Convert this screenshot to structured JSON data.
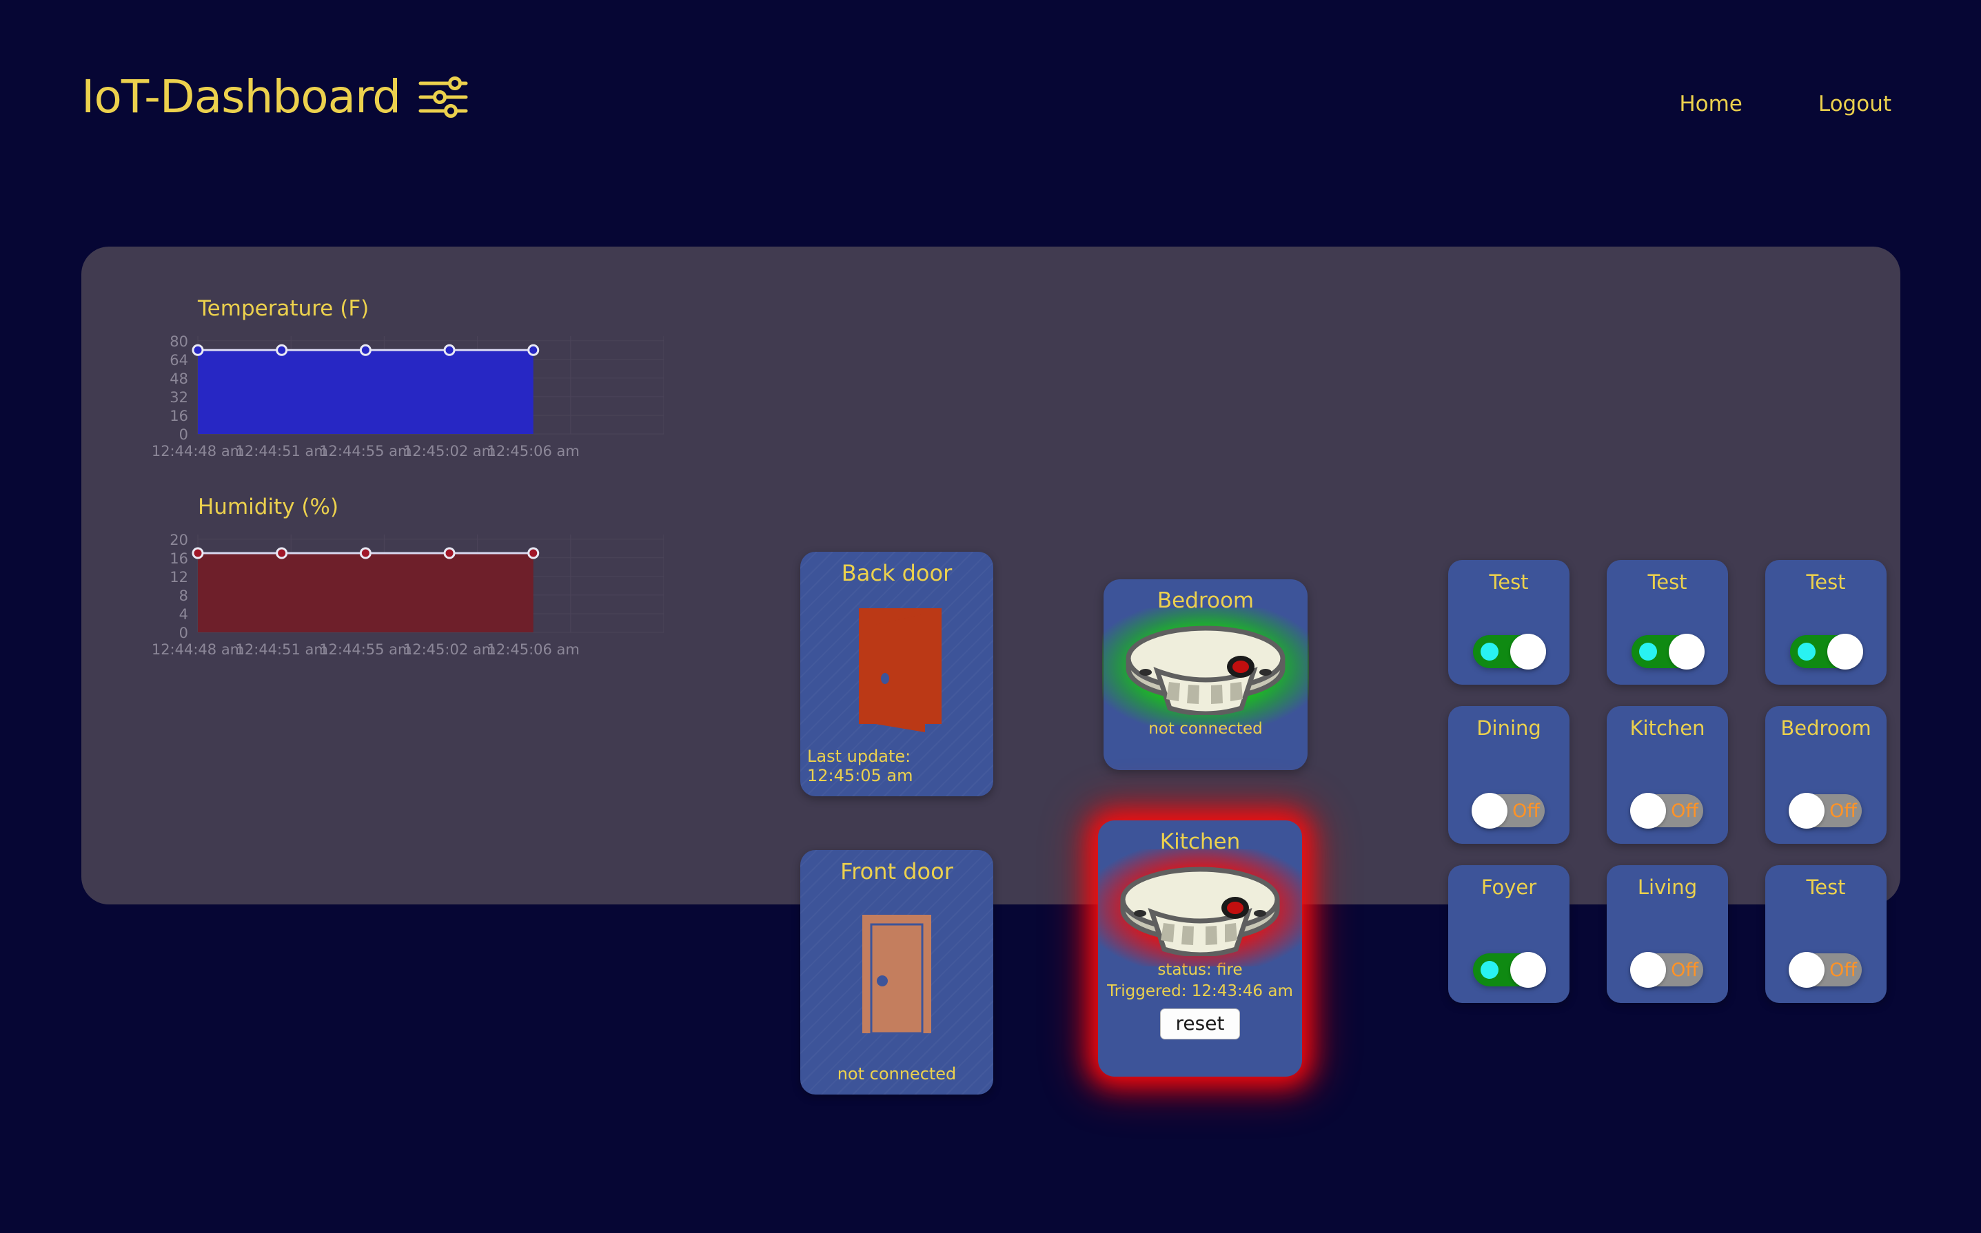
{
  "header": {
    "brand": "IoT-Dashboard",
    "brand_icon": "sliders-icon",
    "nav": [
      {
        "label": "Home"
      },
      {
        "label": "Logout"
      }
    ],
    "brand_color": "#ecd14d"
  },
  "theme": {
    "page_background": "#060634",
    "panel_background": "#413b50",
    "card_background": "#3d5499",
    "accent_yellow": "#ecd14d",
    "toggle_on": "#0f8a12",
    "toggle_off": "#8f8f8f",
    "off_text": "#ff9326",
    "alarm_red": "#ef1414",
    "ok_green": "#19c419"
  },
  "chart_data": [
    {
      "type": "area",
      "title": "Temperature (F)",
      "xlabel": "",
      "ylabel": "",
      "x": [
        "12:44:48 am",
        "12:44:51 am",
        "12:44:55 am",
        "12:45:02 am",
        "12:45:06 am"
      ],
      "values": [
        72,
        72,
        72,
        72,
        72
      ],
      "yticks": [
        0,
        16,
        32,
        48,
        64,
        80
      ],
      "ylim": [
        0,
        84
      ],
      "grid": true,
      "legend": "none",
      "line_color": "#d8d8f0",
      "fill_color": "#2727c4",
      "marker_color": "#2727c4"
    },
    {
      "type": "area",
      "title": "Humidity (%)",
      "xlabel": "",
      "ylabel": "",
      "x": [
        "12:44:48 am",
        "12:44:51 am",
        "12:44:55 am",
        "12:45:02 am",
        "12:45:06 am"
      ],
      "values": [
        17,
        17,
        17,
        17,
        17
      ],
      "yticks": [
        0,
        4,
        8,
        12,
        16,
        20
      ],
      "ylim": [
        0,
        21
      ],
      "grid": true,
      "legend": "none",
      "line_color": "#d8d8f0",
      "fill_color": "#6e1f2a",
      "marker_color": "#a01628"
    }
  ],
  "doors": [
    {
      "name": "Back door",
      "state": "open",
      "status": "Last update: 12:45:05 am",
      "icon": "door-open-icon",
      "color": "#bb3916"
    },
    {
      "name": "Front door",
      "state": "closed",
      "status": "not connected",
      "icon": "door-closed-icon",
      "color": "#c47e5e"
    }
  ],
  "smoke_detectors": [
    {
      "name": "Bedroom",
      "glow": "green",
      "status_lines": [
        "not connected"
      ],
      "has_reset": false,
      "icon": "smoke-detector-icon"
    },
    {
      "name": "Kitchen",
      "glow": "red",
      "status_lines": [
        "status: fire",
        "Triggered: 12:43:46 am"
      ],
      "has_reset": true,
      "reset_label": "reset",
      "icon": "smoke-detector-icon"
    }
  ],
  "switches": [
    {
      "label": "Test",
      "state": "on",
      "state_text": ""
    },
    {
      "label": "Test",
      "state": "on",
      "state_text": ""
    },
    {
      "label": "Test",
      "state": "on",
      "state_text": ""
    },
    {
      "label": "Dining",
      "state": "off",
      "state_text": "Off"
    },
    {
      "label": "Kitchen",
      "state": "off",
      "state_text": "Off"
    },
    {
      "label": "Bedroom",
      "state": "off",
      "state_text": "Off"
    },
    {
      "label": "Foyer",
      "state": "on",
      "state_text": ""
    },
    {
      "label": "Living",
      "state": "off",
      "state_text": "Off"
    },
    {
      "label": "Test",
      "state": "off",
      "state_text": "Off"
    }
  ]
}
